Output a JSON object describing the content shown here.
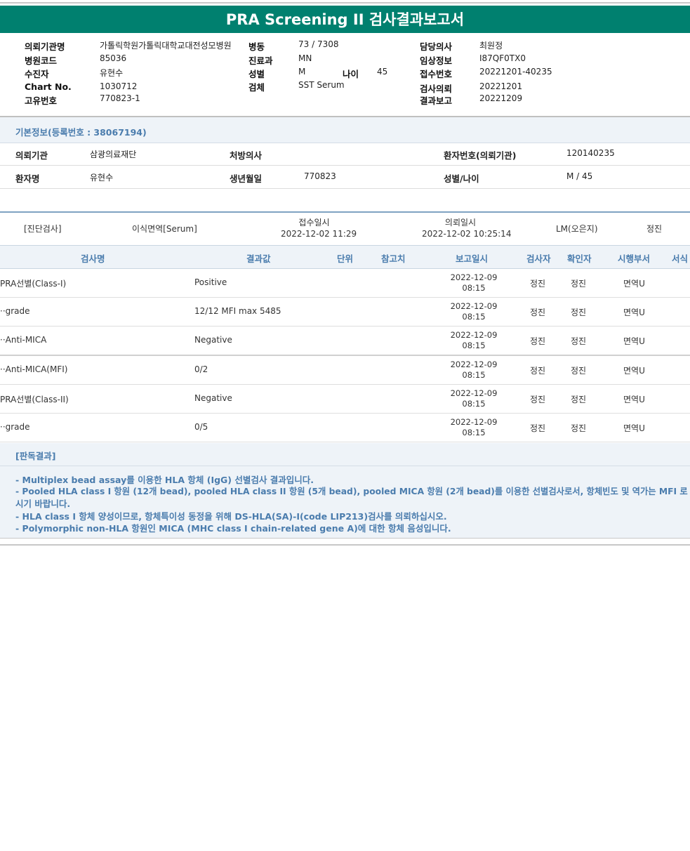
{
  "title": "PRA Screening II 검사결과보고서",
  "header": {
    "institution_label": "의뢰기관명",
    "institution": "가톨릭학원가톨릭대학교대전성모병원",
    "hospital_code_label": "병원코드",
    "hospital_code": "85036",
    "recipient_label": "수진자",
    "recipient": "유현수",
    "chart_no_label": "Chart No.",
    "chart_no": "1030712",
    "unique_no_label": "고유번호",
    "unique_no": "770823-1",
    "ward_label": "병동",
    "ward": "73 / 7308",
    "dept_label": "진료과",
    "dept": "MN",
    "sex_label": "성별",
    "sex": "M",
    "age_label": "나이",
    "age": "45",
    "specimen_label": "검체",
    "specimen": "SST Serum",
    "doctor_label": "담당의사",
    "doctor": "최원정",
    "clinical_label": "임상정보",
    "clinical": "I87QF0TX0",
    "receipt_no_label": "접수번호",
    "receipt_no": "20221201-40235",
    "request_label": "검사의뢰",
    "request": "20221201",
    "report_label": "결과보고",
    "report": "20221209"
  },
  "basic": {
    "title": "기본정보(등록번호 : 38067194)",
    "req_inst_label": "의뢰기관",
    "req_inst": "삼광의료재단",
    "prescriber_label": "처방의사",
    "prescriber": "",
    "patient_no_label": "환자번호(의뢰기관)",
    "patient_no": "120140235",
    "patient_label": "환자명",
    "patient": "유현수",
    "birth_label": "생년월일",
    "birth": "770823",
    "sexage_label": "성별/나이",
    "sexage": "M / 45"
  },
  "diag": {
    "category": "[진단검사]",
    "exam": "이식면역[Serum]",
    "receipt_label": "접수일시",
    "receipt": "2022-12-02  11:29",
    "request_label": "의뢰일시",
    "request": "2022-12-02  10:25:14",
    "lm": "LM(오은지)",
    "person": "정진"
  },
  "table": {
    "headers": [
      "검사명",
      "결과값",
      "단위",
      "참고치",
      "보고일시",
      "검사자",
      "확인자",
      "시행부서",
      "서식"
    ],
    "rows": [
      {
        "name": "PRA선별(Class-I)",
        "result": "Positive",
        "unit": "",
        "ref": "",
        "date": "2022-12-09",
        "time": "08:15",
        "tester": "정진",
        "checker": "정진",
        "dept": "면역U"
      },
      {
        "name": "··grade",
        "result": "12/12 MFI max 5485",
        "unit": "",
        "ref": "",
        "date": "2022-12-09",
        "time": "08:15",
        "tester": "정진",
        "checker": "정진",
        "dept": "면역U"
      },
      {
        "name": "··Anti-MICA",
        "result": "Negative",
        "unit": "",
        "ref": "",
        "date": "2022-12-09",
        "time": "08:15",
        "tester": "정진",
        "checker": "정진",
        "dept": "면역U"
      },
      {
        "name": "··Anti-MICA(MFI)",
        "result": "0/2",
        "unit": "",
        "ref": "",
        "date": "2022-12-09",
        "time": "08:15",
        "tester": "정진",
        "checker": "정진",
        "dept": "면역U"
      },
      {
        "name": "PRA선별(Class-II)",
        "result": "Negative",
        "unit": "",
        "ref": "",
        "date": "2022-12-09",
        "time": "08:15",
        "tester": "정진",
        "checker": "정진",
        "dept": "면역U"
      },
      {
        "name": "··grade",
        "result": "0/5",
        "unit": "",
        "ref": "",
        "date": "2022-12-09",
        "time": "08:15",
        "tester": "정진",
        "checker": "정진",
        "dept": "면역U"
      }
    ]
  },
  "interpretation": {
    "title": "[판독결과]",
    "lines": [
      "- Multiplex bead assay를 이용한 HLA 항체 (IgG) 선별검사 결과입니다.",
      "- Pooled HLA class I 항원 (12개 bead), pooled HLA class II 항원 (5개 bead), pooled MICA 항원 (2개 bead)를 이용한 선별검사로서, 항체빈도 및 역가는 MFI 로 판정하",
      "시기 바랍니다.",
      "- HLA class I 항체 양성이므로, 항체특이성 동정을 위해 DS-HLA(SA)-I(code LIP213)검사를 의뢰하십시오.",
      "- Polymorphic non-HLA 항원인 MICA (MHC class I chain-related gene A)에 대한 항체 음성입니다."
    ]
  }
}
